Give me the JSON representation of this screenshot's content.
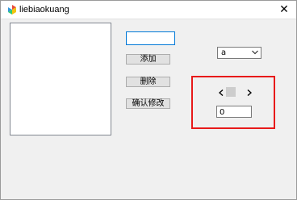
{
  "window": {
    "title": "liebiaokuang",
    "close_symbol": "✕"
  },
  "controls": {
    "text_input_value": "",
    "add_button": "添加",
    "delete_button": "删除",
    "confirm_modify_button": "确认修改",
    "combo_selected": "a",
    "scroll_value": "0"
  },
  "icons": {
    "app": "app-icon",
    "close": "close-icon",
    "combo_arrow": "chevron-down-icon",
    "scroll_left": "chevron-left-icon",
    "scroll_right": "chevron-right-icon"
  },
  "colors": {
    "highlight_border": "#e81a1a",
    "focus_border": "#0078d7"
  }
}
